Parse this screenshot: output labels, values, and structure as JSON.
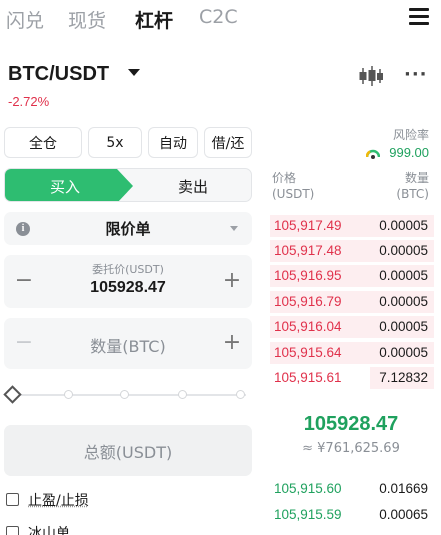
{
  "top_tabs": [
    "闪兑",
    "现货",
    "杠杆",
    "C2C"
  ],
  "active_tab_index": 2,
  "pair": "BTC/USDT",
  "change": "-2.72%",
  "options": [
    "全仓",
    "5x",
    "自动",
    "借/还"
  ],
  "risk": {
    "label": "风险率",
    "value": "999.00"
  },
  "side": {
    "buy": "买入",
    "sell": "卖出"
  },
  "order_type": "限价单",
  "price_field": {
    "label": "委托价(USDT)",
    "value": "105928.47"
  },
  "qty_field": {
    "placeholder": "数量(BTC)"
  },
  "total_button": "总额(USDT)",
  "checkboxes": [
    "止盈/止损",
    "冰山单"
  ],
  "orderbook": {
    "price_header": [
      "价格",
      "(USDT)"
    ],
    "amount_header": [
      "数量",
      "(BTC)"
    ],
    "asks": [
      {
        "price": "105,917.49",
        "amount": "0.00005"
      },
      {
        "price": "105,917.48",
        "amount": "0.00005"
      },
      {
        "price": "105,916.95",
        "amount": "0.00005"
      },
      {
        "price": "105,916.79",
        "amount": "0.00005"
      },
      {
        "price": "105,916.04",
        "amount": "0.00005"
      },
      {
        "price": "105,915.64",
        "amount": "0.00005"
      },
      {
        "price": "105,915.61",
        "amount": "7.12832"
      }
    ],
    "mid_price": "105928.47",
    "mid_fiat": "≈ ¥761,625.69",
    "bids": [
      {
        "price": "105,915.60",
        "amount": "0.01669"
      },
      {
        "price": "105,915.59",
        "amount": "0.00065"
      }
    ]
  },
  "colors": {
    "buy": "#2ebd71",
    "sell": "#e0314b",
    "green_text": "#1fa15e"
  },
  "icons": [
    "menu-icon",
    "caret-down-icon",
    "kline-icon",
    "more-icon",
    "risk-gauge-icon",
    "info-icon",
    "slider-handle-icon"
  ]
}
